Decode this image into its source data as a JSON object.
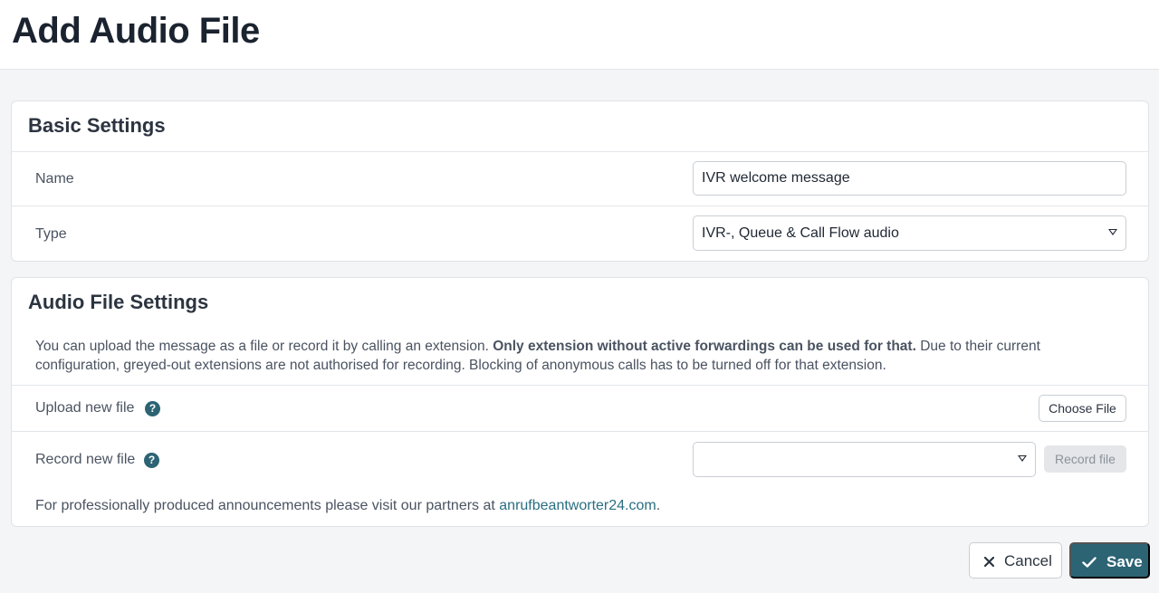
{
  "page": {
    "title": "Add Audio File"
  },
  "basic_settings": {
    "title": "Basic Settings",
    "name_label": "Name",
    "name_value": "IVR welcome message",
    "type_label": "Type",
    "type_value": "IVR-, Queue & Call Flow audio"
  },
  "audio_settings": {
    "title": "Audio File Settings",
    "description_part1": "You can upload the message as a file or record it by calling an extension. ",
    "description_bold": "Only extension without active forwardings can be used for that.",
    "description_part2": " Due to their current configuration, greyed-out extensions are not authorised for recording. Blocking of anonymous calls has to be turned off for that extension.",
    "upload_label": "Upload new file",
    "choose_file_label": "Choose File",
    "record_label": "Record new file",
    "record_extension_value": "",
    "record_button_label": "Record file",
    "partner_text": "For professionally produced announcements please visit our partners at ",
    "partner_link": "anrufbeantworter24.com",
    "partner_suffix": "."
  },
  "footer": {
    "cancel_label": "Cancel",
    "save_label": "Save"
  },
  "icons": {
    "help": "question-mark-circle",
    "cancel": "x",
    "save": "checkmark"
  },
  "colors": {
    "accent": "#2c6474",
    "link": "#2a6f82",
    "background": "#f4f5f7"
  }
}
